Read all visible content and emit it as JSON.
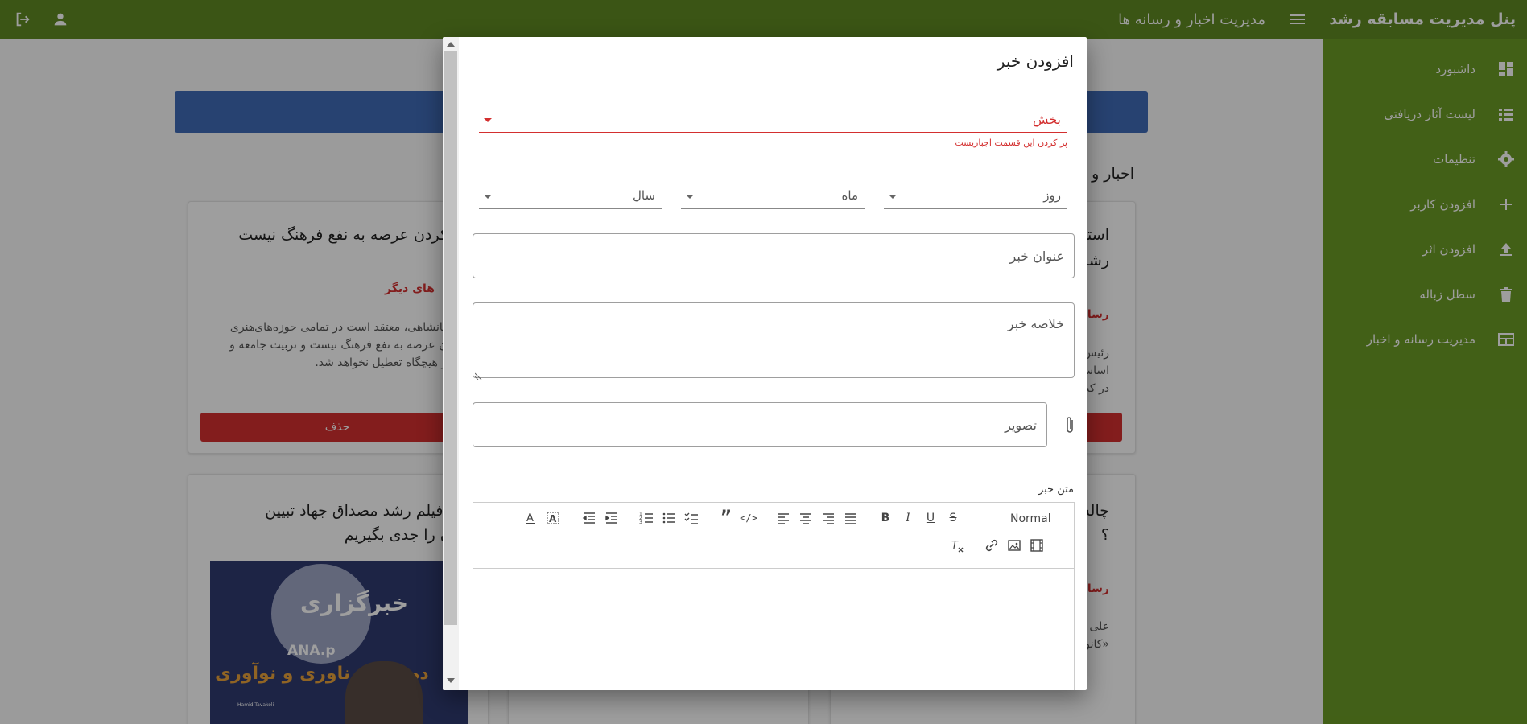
{
  "topbar": {
    "brand": "پنل مدیریت مسابقه رشد",
    "page_heading": "مدیریت اخبار و رسانه ها",
    "menu_icon": "menu-icon",
    "user_icon": "user-icon",
    "logout_icon": "logout-icon"
  },
  "sidebar": {
    "items": [
      {
        "label": "داشبورد",
        "icon": "dashboard-icon"
      },
      {
        "label": "لیست آثار دریافتی",
        "icon": "list-icon"
      },
      {
        "label": "تنظیمات",
        "icon": "gear-icon"
      },
      {
        "label": "افزودن کاربر",
        "icon": "plus-icon"
      },
      {
        "label": "افزودن اثر",
        "icon": "upload-icon"
      },
      {
        "label": "سطل زباله",
        "icon": "trash-icon"
      },
      {
        "label": "مدیریت رسانه و اخبار",
        "icon": "table-icon"
      }
    ]
  },
  "background": {
    "section_title": "اخبار و",
    "cards": [
      {
        "title": "ن کردن عرصه به نفع فرهنگ نیست",
        "media": "های دیگر",
        "lines": [
          "د جهانشاهی، معتقد است در تمامی حوزه‌های‌هنری",
          "کردن عرصه به نفع فرهنگ نیست و تربیت جامعه و",
          "ه نیز هیچگاه تعطیل نخواهد شد."
        ],
        "delete_label": "حذف"
      },
      {
        "title_lines": [
          "استن",
          "رشد"
        ],
        "media": "رسانه",
        "lines": [
          "رئیس",
          "اساس",
          "در کت"
        ]
      },
      {
        "title_lines": [
          "نواره فیلم رشد مصداق جهاد تبیین",
          "ت؛ آن را جدی بگیریم"
        ]
      },
      {
        "title_lines": [
          "چالش",
          "؟"
        ],
        "media": "رسانه",
        "lines": [
          "علی ج",
          "«کانو"
        ]
      }
    ],
    "image_text": [
      "خبرگزاری",
      "ANA.p",
      "ده بان ع ناوری و نوآوری",
      "Hamid Tavakoli"
    ]
  },
  "dialog": {
    "title": "افزودن خبر",
    "section_label": "بخش",
    "section_error": "پر کردن این قسمت اجباریست",
    "day_label": "روز",
    "month_label": "ماه",
    "year_label": "سال",
    "news_title_placeholder": "عنوان خبر",
    "summary_placeholder": "خلاصه خبر",
    "image_placeholder": "تصویر",
    "body_label": "متن خبر",
    "editor_format": "Normal"
  },
  "colors": {
    "topbar": "#5f8a23",
    "sidebar": "#6b9b26",
    "error": "#d32f2f",
    "blue_bar": "#3f6bb7"
  }
}
